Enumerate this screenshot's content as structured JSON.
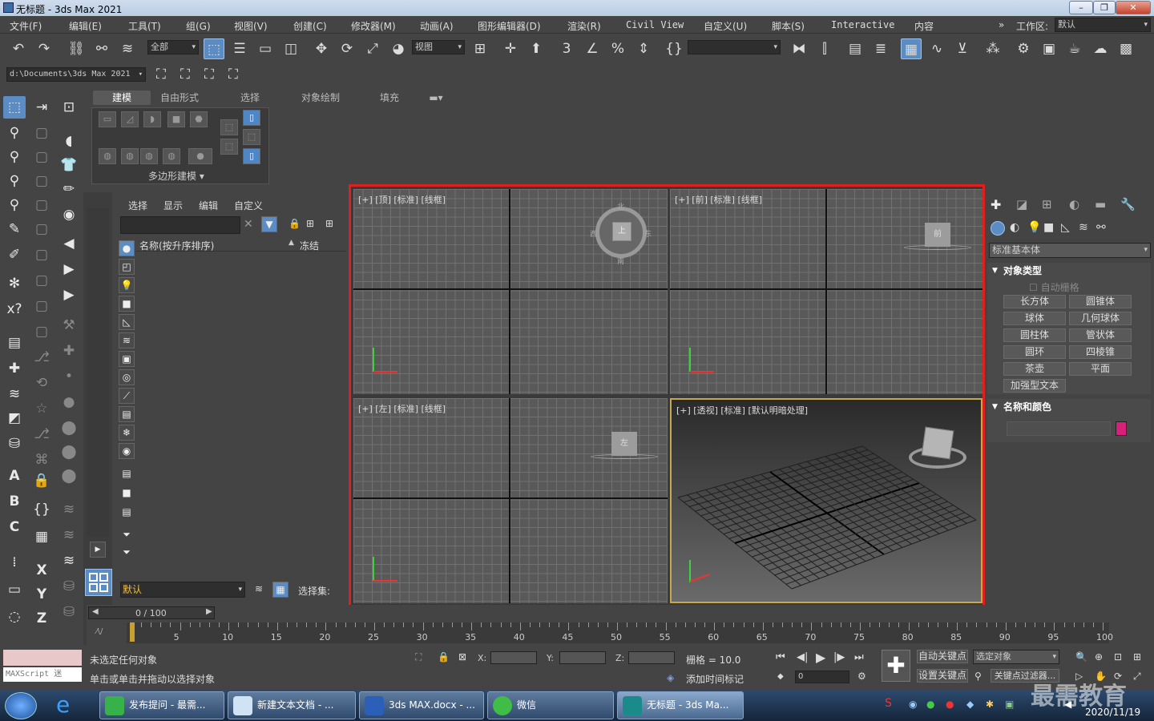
{
  "window": {
    "title": "无标题 - 3ds Max 2021"
  },
  "menu": [
    "文件(F)",
    "编辑(E)",
    "工具(T)",
    "组(G)",
    "视图(V)",
    "创建(C)",
    "修改器(M)",
    "动画(A)",
    "图形编辑器(D)",
    "渲染(R)",
    "Civil View",
    "自定义(U)",
    "脚本(S)",
    "Interactive",
    "内容"
  ],
  "workspace": {
    "label": "工作区:",
    "value": "默认"
  },
  "toolbar": {
    "filter": "全部",
    "refcoord": "视图"
  },
  "path": "d:\\Documents\\3ds Max 2021",
  "ribbon": {
    "tabs": [
      "建模",
      "自由形式",
      "选择",
      "对象绘制",
      "填充"
    ],
    "group": "多边形建模"
  },
  "scene": {
    "tabs": [
      "选择",
      "显示",
      "编辑",
      "自定义"
    ],
    "col_name": "名称(按升序排序)",
    "col_frozen": "冻结",
    "layer": "默认",
    "selset": "选择集:"
  },
  "viewports": {
    "top": "[+] [顶] [标准] [线框]",
    "front": "[+] [前] [标准] [线框]",
    "left": "[+] [左] [标准] [线框]",
    "persp": "[+] [透视] [标准] [默认明暗处理]",
    "cube_top": "上",
    "cube_front": "前",
    "cube_left": "左",
    "compass_n": "北",
    "compass_s": "南",
    "compass_w": "西",
    "compass_e": "东"
  },
  "command": {
    "dropdown": "标准基本体",
    "sec1": "对象类型",
    "autogrid": "自动栅格",
    "buttons": [
      "长方体",
      "圆锥体",
      "球体",
      "几何球体",
      "圆柱体",
      "管状体",
      "圆环",
      "四棱锥",
      "茶壶",
      "平面",
      "加强型文本"
    ],
    "sec2": "名称和颜色",
    "color": "#d81f7a"
  },
  "timeline": {
    "range": "0 / 100",
    "ticks": [
      "5",
      "10",
      "15",
      "20",
      "25",
      "30",
      "35",
      "40",
      "45",
      "50",
      "55",
      "60",
      "65",
      "70",
      "75",
      "80",
      "85",
      "90",
      "95",
      "100"
    ]
  },
  "status": {
    "maxscript": "MAXScript 迷",
    "line1": "未选定任何对象",
    "line2": "单击或单击并拖动以选择对象",
    "x": "X:",
    "y": "Y:",
    "z": "Z:",
    "grid": "栅格 = 10.0",
    "addtime": "添加时间标记",
    "autokey": "自动关键点",
    "selobj": "选定对象",
    "setkey": "设置关键点",
    "keyfilter": "关键点过滤器...",
    "frame": "0"
  },
  "taskbar": {
    "items": [
      "发布提问 - 最需...",
      "新建文本文档 - ...",
      "3ds MAX.docx - ...",
      "微信",
      "无标题 - 3ds Ma..."
    ],
    "time": "2020/11/19",
    "watermark": "最需教育"
  }
}
